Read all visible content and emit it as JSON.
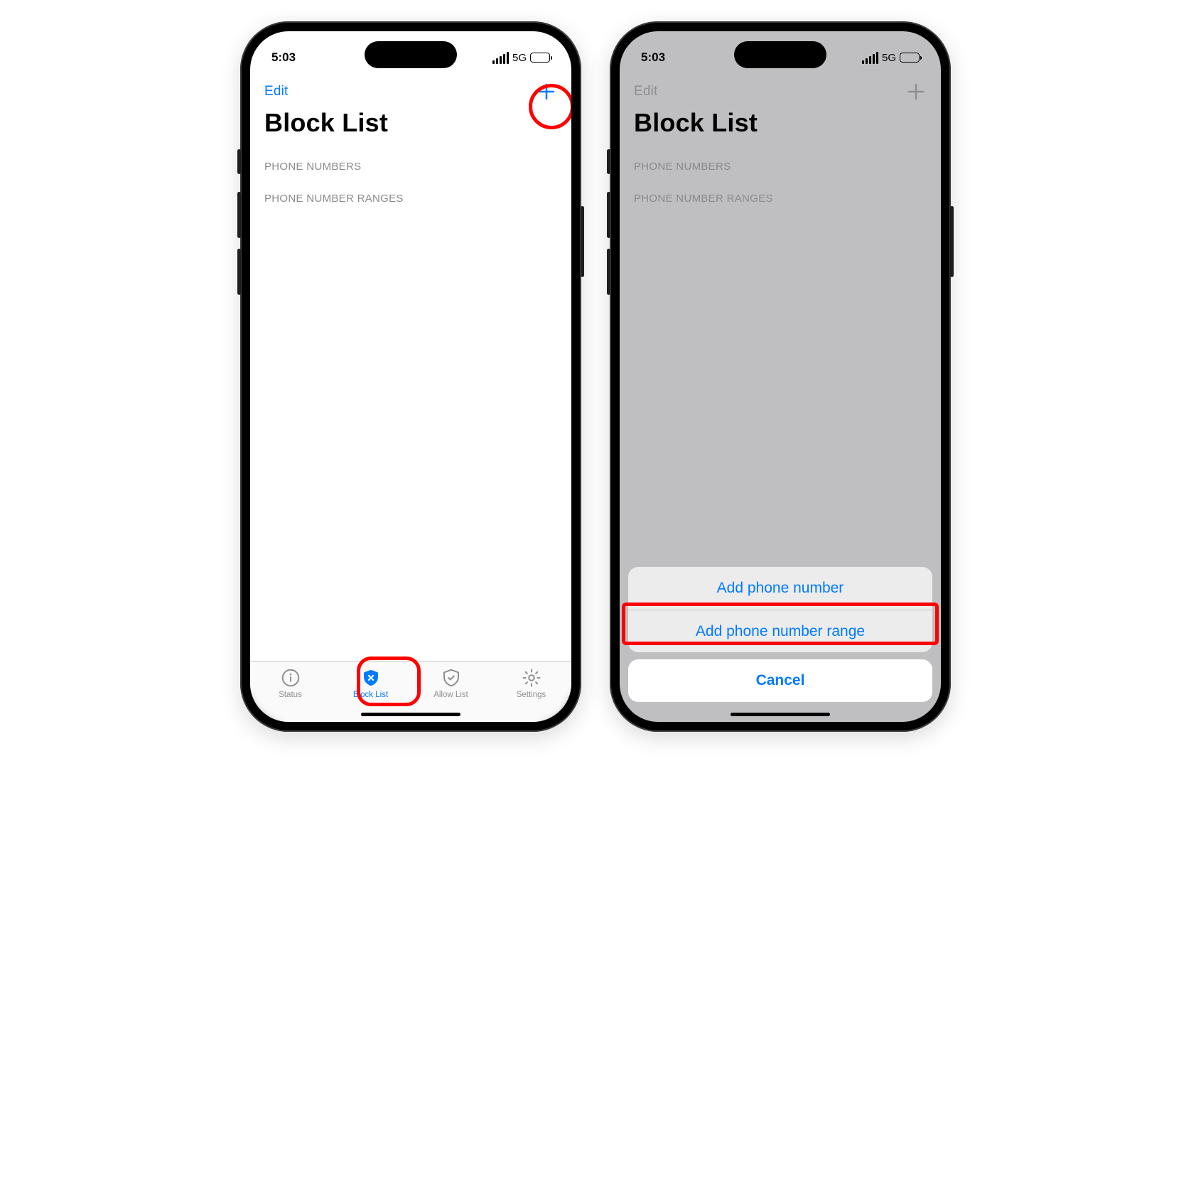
{
  "statusbar": {
    "time": "5:03",
    "network": "5G"
  },
  "nav": {
    "edit": "Edit"
  },
  "page": {
    "title": "Block List"
  },
  "sections": {
    "phone_numbers": "PHONE NUMBERS",
    "phone_number_ranges": "PHONE NUMBER RANGES"
  },
  "tabs": {
    "status": "Status",
    "block_list": "Block List",
    "allow_list": "Allow List",
    "settings": "Settings"
  },
  "sheet": {
    "add_number": "Add phone number",
    "add_range": "Add phone number range",
    "cancel": "Cancel"
  }
}
